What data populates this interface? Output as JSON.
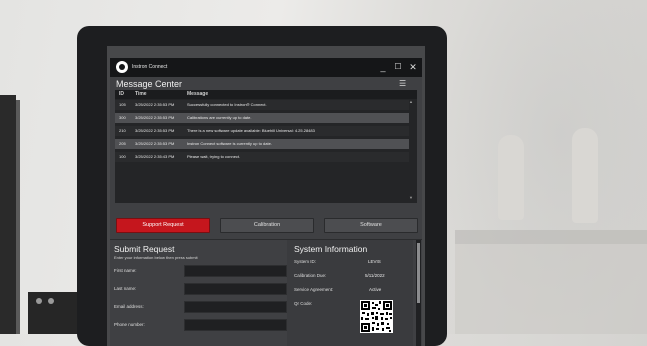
{
  "app": {
    "title": "Instron Connect"
  },
  "window_controls": {
    "minimize": "_",
    "maximize": "☐",
    "close": "✕"
  },
  "message_center": {
    "title": "Message Center",
    "menu_icon": "☰",
    "columns": [
      "ID",
      "Time",
      "Message"
    ],
    "rows": [
      {
        "id": "105",
        "time": "3/25/2022 2:35:53 PM",
        "message": "Successfully connected to Instron® Connect."
      },
      {
        "id": "300",
        "time": "3/25/2022 2:35:53 PM",
        "message": "Calibrations are currently up to date."
      },
      {
        "id": "210",
        "time": "3/25/2022 2:35:53 PM",
        "message": "There is a new software update available: Bluehill Universal: 4.25.28483"
      },
      {
        "id": "205",
        "time": "3/25/2022 2:35:53 PM",
        "message": "Instron Connect software is currently up to date."
      },
      {
        "id": "100",
        "time": "3/25/2022 2:35:43 PM",
        "message": "Please wait, trying to connect."
      }
    ]
  },
  "tabs": {
    "support": "Support Request",
    "calibration": "Calibration",
    "software": "Software"
  },
  "submit_request": {
    "title": "Submit Request",
    "hint": "Enter your information below then press submit",
    "fields": [
      "First name:",
      "Last name:",
      "Email address:",
      "Phone number:"
    ]
  },
  "system_information": {
    "title": "System Information",
    "items": [
      {
        "label": "System ID:",
        "value": "LEVIS"
      },
      {
        "label": "Calibration Due:",
        "value": "5/11/2022"
      },
      {
        "label": "Service Agreement:",
        "value": "Active"
      },
      {
        "label": "Qr Code:",
        "value": ""
      }
    ]
  },
  "colors": {
    "accent": "#c5161d",
    "window_bg": "#3f4043",
    "titlebar": "#151618"
  }
}
